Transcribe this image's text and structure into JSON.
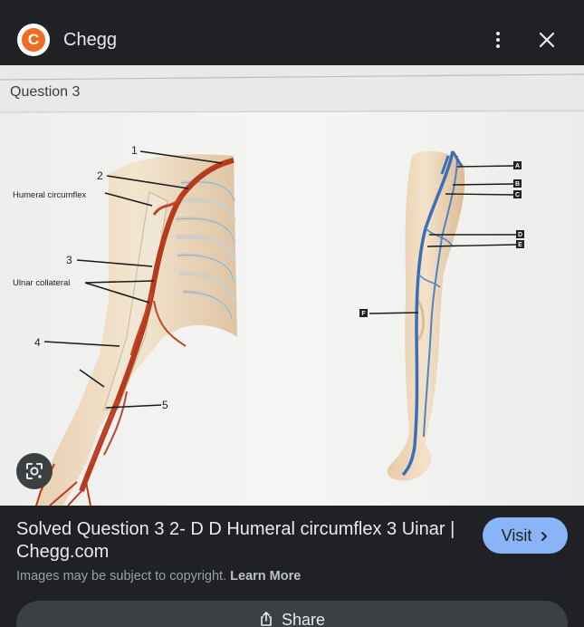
{
  "header": {
    "site_logo_letter": "C",
    "site_name": "Chegg",
    "more_icon": "more-vert-icon",
    "close_icon": "close-icon"
  },
  "image": {
    "heading": "Question 3",
    "arm_labels": {
      "humeral": "Humeral circumflex",
      "ulnar": "Ulnar collateral",
      "n1": "1",
      "n2": "2",
      "n3": "3",
      "n4": "4",
      "n5": "5"
    },
    "leg_labels": [
      "A",
      "B",
      "C",
      "D",
      "E",
      "F"
    ],
    "lens_icon": "google-lens-icon"
  },
  "result": {
    "title": "Solved Question 3 2- D D Humeral circumflex 3 Uinar | Chegg.com",
    "visit_label": "Visit",
    "visit_icon": "chevron-right-icon",
    "copyright_text": "Images may be subject to copyright.",
    "learn_more": "Learn More",
    "share_label": "Share",
    "share_icon": "share-icon"
  },
  "colors": {
    "background": "#202124",
    "visit_button": "#8ab4f8",
    "logo": "#f06b23",
    "artery": "#b83a1c",
    "vein": "#3a6fb8"
  }
}
